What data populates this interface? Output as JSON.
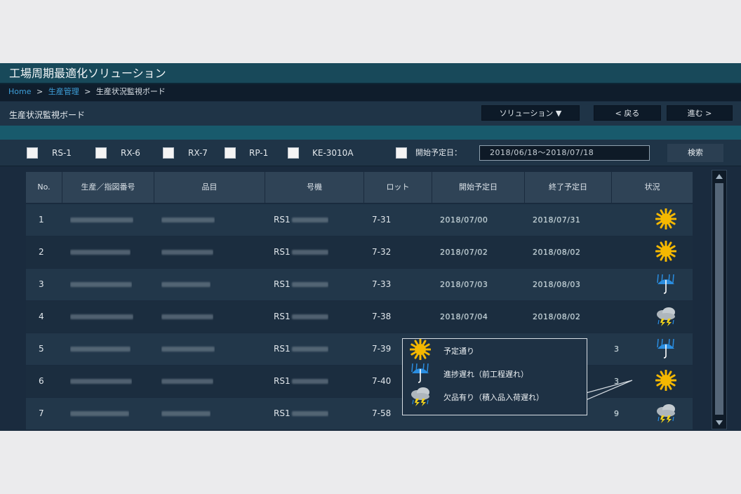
{
  "app": {
    "title": "工場周期最適化ソリューション"
  },
  "breadcrumb": {
    "home": "Home",
    "sep1": ">",
    "parent": "生産管理",
    "sep2": ">",
    "current": "生産状況監視ボード"
  },
  "header": {
    "page_title": "生産状況監視ボード",
    "solution_button": "ソリューション ▼",
    "back_button": "< 戻る",
    "next_button": "進む >"
  },
  "filters": {
    "checkboxes": [
      "RS-1",
      "RX-6",
      "RX-7",
      "RP-1",
      "KE-3010A"
    ],
    "date_label": "開始予定日：",
    "date_range": "2018/06/18～2018/07/18",
    "search_button": "検索"
  },
  "table": {
    "headers": [
      "No.",
      "生産／指図番号",
      "品目",
      "号機",
      "ロット",
      "開始予定日",
      "終了予定日",
      "状況"
    ],
    "rows": [
      {
        "no": "1",
        "machine": "RS1",
        "lot": "7-31",
        "start": "2018/07/00",
        "end": "2018/07/31",
        "status": "sunny-icon"
      },
      {
        "no": "2",
        "machine": "RS1",
        "lot": "7-32",
        "start": "2018/07/02",
        "end": "2018/08/02",
        "status": "sunny-icon"
      },
      {
        "no": "3",
        "machine": "RS1",
        "lot": "7-33",
        "start": "2018/07/03",
        "end": "2018/08/03",
        "status": "rain-icon"
      },
      {
        "no": "4",
        "machine": "RS1",
        "lot": "7-38",
        "start": "2018/07/04",
        "end": "2018/08/02",
        "status": "storm-icon"
      },
      {
        "no": "5",
        "machine": "RS1",
        "lot": "7-39",
        "start": "",
        "end": "3",
        "status": "rain-icon"
      },
      {
        "no": "6",
        "machine": "RS1",
        "lot": "7-40",
        "start": "",
        "end": "3",
        "status": "sunny-icon"
      },
      {
        "no": "7",
        "machine": "RS1",
        "lot": "7-58",
        "start": "",
        "end": "9",
        "status": "storm-icon"
      }
    ]
  },
  "legend": {
    "items": [
      {
        "icon": "sunny-icon",
        "label": "予定通り"
      },
      {
        "icon": "rain-icon",
        "label": "進捗遅れ（前工程遅れ）"
      },
      {
        "icon": "storm-icon",
        "label": "欠品有り（積入品入荷遅れ）"
      }
    ]
  },
  "colors": {
    "title_bar": "#18495a",
    "sunny": "#f5b800",
    "rain": "#2a8de0",
    "storm_cloud": "#aeb6bc",
    "storm_bolt": "#f2d21a"
  }
}
